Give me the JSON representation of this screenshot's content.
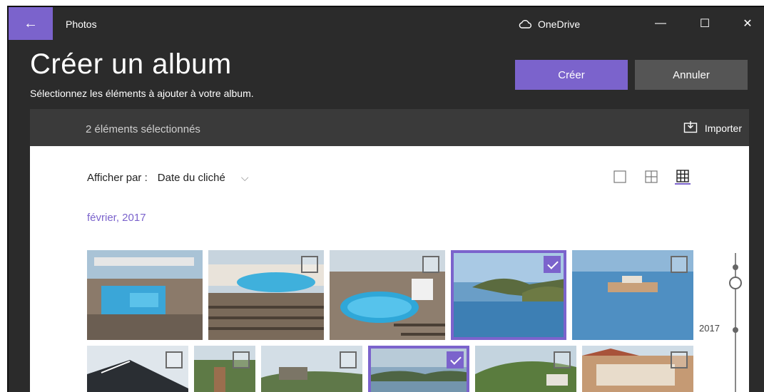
{
  "app": {
    "title": "Photos",
    "onedrive_label": "OneDrive"
  },
  "header": {
    "title": "Créer un album",
    "subtitle": "Sélectionnez les éléments à ajouter à votre album.",
    "create_label": "Créer",
    "cancel_label": "Annuler"
  },
  "selection_bar": {
    "count_text": "2 éléments sélectionnés",
    "import_label": "Importer"
  },
  "toolbar": {
    "view_by_label": "Afficher par :",
    "view_by_value": "Date du cliché"
  },
  "gallery": {
    "month_label": "février, 2017",
    "photos_row1": [
      {
        "subject": "ship-pool-deck",
        "selected": false
      },
      {
        "subject": "lounge-chairs-pool",
        "selected": false
      },
      {
        "subject": "round-pool",
        "selected": false
      },
      {
        "subject": "bay-coastline",
        "selected": true
      },
      {
        "subject": "ship-at-sea",
        "selected": false
      }
    ],
    "photos_row2": [
      {
        "subject": "ship-bow",
        "selected": false
      },
      {
        "subject": "church-tower",
        "selected": false
      },
      {
        "subject": "fort-hill",
        "selected": false
      },
      {
        "subject": "harbor-view",
        "selected": true
      },
      {
        "subject": "green-hillside",
        "selected": false
      },
      {
        "subject": "town-buildings",
        "selected": false
      }
    ]
  },
  "timeline": {
    "year_label": "2017"
  },
  "colors": {
    "accent": "#7b63cc",
    "titlebar_bg": "#2b2b2b",
    "cancel_bg": "#555555"
  }
}
